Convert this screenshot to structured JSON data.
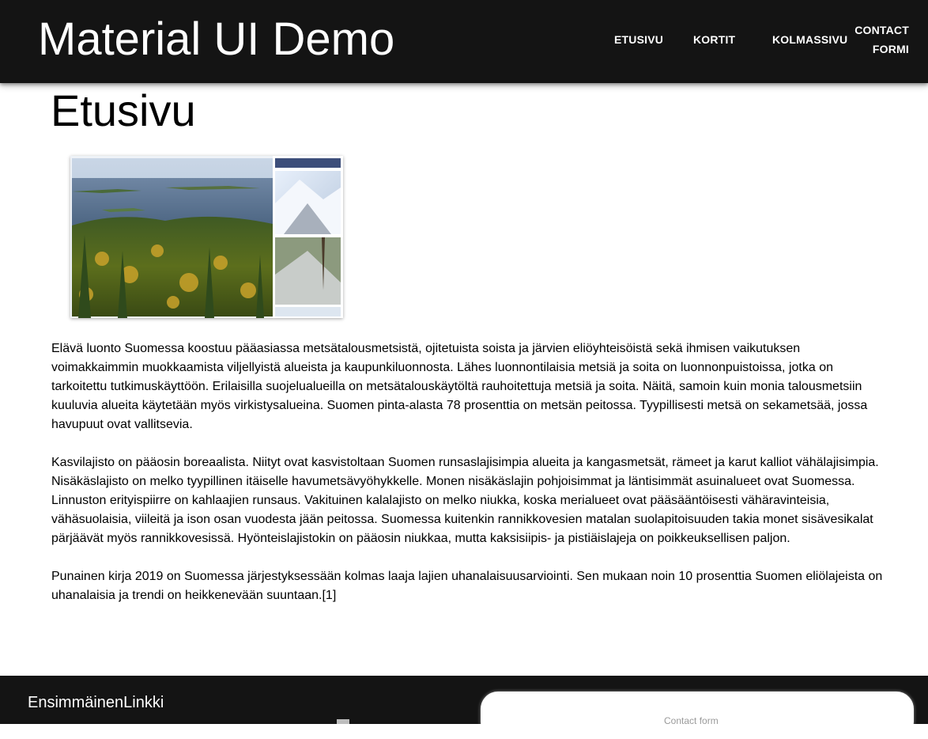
{
  "appbar": {
    "title": "Material UI Demo",
    "nav": [
      {
        "label": "ETUSIVU"
      },
      {
        "label": "KORTIT"
      },
      {
        "label": "KOLMASSIVU"
      },
      {
        "label": "CONTACT FORMI"
      }
    ]
  },
  "main": {
    "title": "Etusivu",
    "paragraphs": [
      "Elävä luonto Suomessa koostuu pääasiassa metsätalousmetsistä, ojitetuista soista ja järvien eliöyhteisöistä sekä ihmisen vaikutuksen voimakkaimmin muokkaamista viljellyistä alueista ja kaupunkiluonnosta. Lähes luonnontilaisia metsiä ja soita on luonnonpuistoissa, jotka on tarkoitettu tutkimuskäyttöön. Erilaisilla suojelualueilla on metsätalouskäytöltä rauhoitettuja metsiä ja soita. Näitä, samoin kuin monia talousmetsiin kuuluvia alueita käytetään myös virkistysalueina. Suomen pinta-alasta 78 prosenttia on metsän peitossa. Tyypillisesti metsä on sekametsää, jossa havupuut ovat vallitsevia.",
      "Kasvilajisto on pääosin boreaalista. Niityt ovat kasvistoltaan Suomen runsaslajisimpia alueita ja kangasmetsät, rämeet ja karut kalliot vähälajisimpia. Nisäkäslajisto on melko tyypillinen itäiselle havumetsävyöhykkelle. Monen nisäkäslajin pohjoisimmat ja läntisimmät asuinalueet ovat Suomessa. Linnuston erityispiirre on kahlaajien runsaus. Vakituinen kalalajisto on melko niukka, koska merialueet ovat pääsääntöisesti vähäravinteisia, vähäsuolaisia, viileitä ja ison osan vuodesta jään peitossa. Suomessa kuitenkin rannikkovesien matalan suolapitoisuuden takia monet sisävesikalat pärjäävät myös rannikkovesissä. Hyönteislajistokin on pääosin niukkaa, mutta kaksisiipis- ja pistiäislajeja on poikkeuksellisen paljon.",
      "Punainen kirja 2019 on Suomessa järjestyksessään kolmas laaja lajien uhanalaisuusarviointi. Sen mukaan noin 10 prosenttia Suomen eliölajeista on uhanalaisia ja trendi on heikkenevään suuntaan.[1]"
    ]
  },
  "footer": {
    "link": "EnsimmäinenLinkki",
    "form_title": "Contact form"
  },
  "colors": {
    "appbar_bg": "#141414",
    "text": "#000000",
    "appbar_text": "#ffffff"
  }
}
